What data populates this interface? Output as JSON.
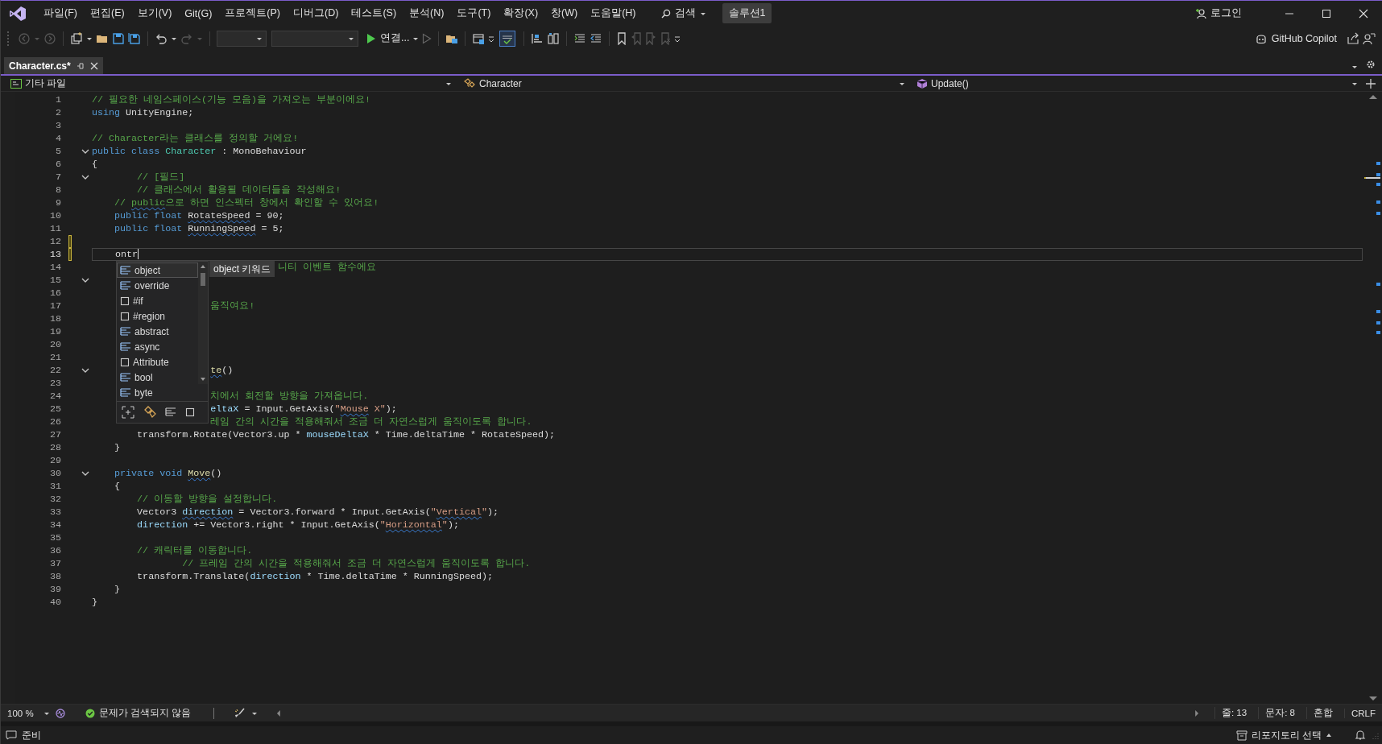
{
  "title_bar": {
    "menu": [
      "파일(F)",
      "편집(E)",
      "보기(V)",
      "Git(G)",
      "프로젝트(P)",
      "디버그(D)",
      "테스트(S)",
      "분석(N)",
      "도구(T)",
      "확장(X)",
      "창(W)",
      "도움말(H)"
    ],
    "search": "검색",
    "solution": "솔루션1",
    "login": "로그인"
  },
  "toolbar": {
    "run_label": "연결...",
    "copilot": "GitHub Copilot"
  },
  "tabs": [
    {
      "label": "Character.cs*",
      "selected": true
    }
  ],
  "nav_bar": {
    "project": "기타 파일",
    "type": "Character",
    "member": "Update()"
  },
  "editor": {
    "lines": [
      {
        "number": "1",
        "fold": false,
        "changed": false,
        "current": false,
        "tokens": [
          {
            "text": "// 필요한 네임스페이스(기능 모음)을 가져오는 부분이에요!",
            "kind": "comment"
          }
        ]
      },
      {
        "number": "2",
        "fold": false,
        "changed": false,
        "current": false,
        "tokens": [
          {
            "text": "using",
            "kind": "keyword"
          },
          {
            "text": " UnityEngine;",
            "kind": "plain"
          }
        ]
      },
      {
        "number": "3",
        "fold": false,
        "changed": false,
        "current": false
      },
      {
        "number": "4",
        "fold": false,
        "changed": false,
        "current": false,
        "tokens": [
          {
            "text": "// Character라는 클래스를 정의할 거에요!",
            "kind": "comment"
          }
        ]
      },
      {
        "number": "5",
        "fold": true,
        "changed": false,
        "current": false,
        "tokens": [
          {
            "text": "public class ",
            "kind": "keyword"
          },
          {
            "text": "Character",
            "kind": "type"
          },
          {
            "text": " : MonoBehaviour",
            "kind": "plain"
          }
        ]
      },
      {
        "number": "6",
        "fold": false,
        "changed": false,
        "current": false,
        "tokens": [
          {
            "text": "{",
            "kind": "plain"
          }
        ]
      },
      {
        "number": "7",
        "fold": true,
        "changed": false,
        "current": false,
        "tokens": [
          {
            "text": "        // [필드]",
            "kind": "comment"
          }
        ]
      },
      {
        "number": "8",
        "fold": false,
        "changed": false,
        "current": false,
        "tokens": [
          {
            "text": "        // 클래스에서 활용될 데이터들을 작성해요!",
            "kind": "comment"
          }
        ]
      },
      {
        "number": "9",
        "fold": false,
        "changed": false,
        "current": false,
        "tokens": [
          {
            "text": "    // ",
            "kind": "comment"
          },
          {
            "text": "public",
            "kind": "comment-squiggle"
          },
          {
            "text": "으로 하면 인스펙터 창에서 확인할 수 있어요!",
            "kind": "comment"
          }
        ]
      },
      {
        "number": "10",
        "fold": false,
        "changed": false,
        "current": false,
        "tokens": [
          {
            "text": "    public float ",
            "kind": "keyword"
          },
          {
            "text": "RotateSpeed",
            "kind": "plain-squiggle"
          },
          {
            "text": " = 90;",
            "kind": "plain"
          }
        ]
      },
      {
        "number": "11",
        "fold": false,
        "changed": false,
        "current": false,
        "tokens": [
          {
            "text": "    public float ",
            "kind": "keyword"
          },
          {
            "text": "RunningSpeed",
            "kind": "plain-squiggle"
          },
          {
            "text": " = 5;",
            "kind": "plain"
          }
        ]
      },
      {
        "number": "12",
        "fold": false,
        "changed": true,
        "current": false
      },
      {
        "number": "13",
        "fold": false,
        "changed": true,
        "current": true,
        "tokens": [
          {
            "text": "    ontr",
            "kind": "plain"
          }
        ]
      },
      {
        "number": "14",
        "fold": false,
        "changed": false,
        "current": false,
        "tokens": [
          {
            "text": "                                 니티 이벤트 함수에요",
            "kind": "comment"
          }
        ]
      },
      {
        "number": "15",
        "fold": true,
        "changed": false,
        "current": false
      },
      {
        "number": "16",
        "fold": false,
        "changed": false,
        "current": false
      },
      {
        "number": "17",
        "fold": false,
        "changed": false,
        "current": false,
        "tokens": [
          {
            "text": "                     움직여요!",
            "kind": "comment"
          }
        ]
      },
      {
        "number": "18",
        "fold": false,
        "changed": false,
        "current": false
      },
      {
        "number": "19",
        "fold": false,
        "changed": false,
        "current": false
      },
      {
        "number": "20",
        "fold": false,
        "changed": false,
        "current": false
      },
      {
        "number": "21",
        "fold": false,
        "changed": false,
        "current": false
      },
      {
        "number": "22",
        "fold": true,
        "changed": false,
        "current": false,
        "tokens": [
          {
            "text": "                     te",
            "kind": "method-squiggle"
          },
          {
            "text": "()",
            "kind": "plain"
          }
        ]
      },
      {
        "number": "23",
        "fold": false,
        "changed": false,
        "current": false
      },
      {
        "number": "24",
        "fold": false,
        "changed": false,
        "current": false,
        "tokens": [
          {
            "text": "                     치에서 회전할 방향을 가져옵니다.",
            "kind": "comment"
          }
        ]
      },
      {
        "number": "25",
        "fold": false,
        "changed": false,
        "current": false,
        "tokens": [
          {
            "text": "                     eltaX",
            "kind": "variable"
          },
          {
            "text": " = Input.GetAxis(",
            "kind": "plain"
          },
          {
            "text": "\"",
            "kind": "string"
          },
          {
            "text": "Mouse",
            "kind": "string-squiggle"
          },
          {
            "text": " X\"",
            "kind": "string"
          },
          {
            "text": ");",
            "kind": "plain"
          }
        ]
      },
      {
        "number": "26",
        "fold": false,
        "changed": false,
        "current": false,
        "tokens": [
          {
            "text": "                     레임 간의 시간을 적용해줘서 조금 더 자연스럽게 움직이도록 합니다.",
            "kind": "comment"
          }
        ]
      },
      {
        "number": "27",
        "fold": false,
        "changed": false,
        "current": false,
        "tokens": [
          {
            "text": "        transform.Rotate(Vector3.up * ",
            "kind": "plain"
          },
          {
            "text": "mouseDeltaX",
            "kind": "variable"
          },
          {
            "text": " * Time.deltaTime * RotateSpeed);",
            "kind": "plain"
          }
        ]
      },
      {
        "number": "28",
        "fold": false,
        "changed": false,
        "current": false,
        "tokens": [
          {
            "text": "    }",
            "kind": "plain"
          }
        ]
      },
      {
        "number": "29",
        "fold": false,
        "changed": false,
        "current": false
      },
      {
        "number": "30",
        "fold": true,
        "changed": false,
        "current": false,
        "tokens": [
          {
            "text": "    private void ",
            "kind": "keyword"
          },
          {
            "text": "Move",
            "kind": "method-squiggle"
          },
          {
            "text": "()",
            "kind": "plain"
          }
        ]
      },
      {
        "number": "31",
        "fold": false,
        "changed": false,
        "current": false,
        "tokens": [
          {
            "text": "    {",
            "kind": "plain"
          }
        ]
      },
      {
        "number": "32",
        "fold": false,
        "changed": false,
        "current": false,
        "tokens": [
          {
            "text": "        // 이동할 방향을 설정합니다.",
            "kind": "comment"
          }
        ]
      },
      {
        "number": "33",
        "fold": false,
        "changed": false,
        "current": false,
        "tokens": [
          {
            "text": "        Vector3 ",
            "kind": "plain"
          },
          {
            "text": "direction",
            "kind": "variable-squiggle"
          },
          {
            "text": " = Vector3.forward * Input.GetAxis(",
            "kind": "plain"
          },
          {
            "text": "\"",
            "kind": "string"
          },
          {
            "text": "Vertical",
            "kind": "string-squiggle"
          },
          {
            "text": "\"",
            "kind": "string"
          },
          {
            "text": ");",
            "kind": "plain"
          }
        ]
      },
      {
        "number": "34",
        "fold": false,
        "changed": false,
        "current": false,
        "tokens": [
          {
            "text": "        direction",
            "kind": "variable"
          },
          {
            "text": " += Vector3.right * Input.GetAxis(",
            "kind": "plain"
          },
          {
            "text": "\"",
            "kind": "string"
          },
          {
            "text": "Horizontal",
            "kind": "string-squiggle"
          },
          {
            "text": "\"",
            "kind": "string"
          },
          {
            "text": ");",
            "kind": "plain"
          }
        ]
      },
      {
        "number": "35",
        "fold": false,
        "changed": false,
        "current": false
      },
      {
        "number": "36",
        "fold": false,
        "changed": false,
        "current": false,
        "tokens": [
          {
            "text": "        // 캐릭터를 이동합니다.",
            "kind": "comment"
          }
        ]
      },
      {
        "number": "37",
        "fold": false,
        "changed": false,
        "current": false,
        "tokens": [
          {
            "text": "                // 프레임 간의 시간을 적용해줘서 조금 더 자연스럽게 움직이도록 합니다.",
            "kind": "comment"
          }
        ]
      },
      {
        "number": "38",
        "fold": false,
        "changed": false,
        "current": false,
        "tokens": [
          {
            "text": "        transform.Translate(",
            "kind": "plain"
          },
          {
            "text": "direction",
            "kind": "variable"
          },
          {
            "text": " * Time.deltaTime * RunningSpeed);",
            "kind": "plain"
          }
        ]
      },
      {
        "number": "39",
        "fold": false,
        "changed": false,
        "current": false,
        "tokens": [
          {
            "text": "    }",
            "kind": "plain"
          }
        ]
      },
      {
        "number": "40",
        "fold": false,
        "changed": false,
        "current": false,
        "tokens": [
          {
            "text": "}",
            "kind": "plain"
          }
        ]
      }
    ],
    "completion": {
      "items": [
        {
          "label": "object",
          "kind": "keyword",
          "selected": true
        },
        {
          "label": "override",
          "kind": "keyword",
          "selected": false
        },
        {
          "label": "#if",
          "kind": "snippet",
          "selected": false
        },
        {
          "label": "#region",
          "kind": "snippet",
          "selected": false
        },
        {
          "label": "abstract",
          "kind": "keyword",
          "selected": false
        },
        {
          "label": "async",
          "kind": "keyword",
          "selected": false
        },
        {
          "label": "Attribute",
          "kind": "snippet",
          "selected": false
        },
        {
          "label": "bool",
          "kind": "keyword",
          "selected": false
        },
        {
          "label": "byte",
          "kind": "keyword",
          "selected": false
        }
      ],
      "tooltip": "object 키워드"
    }
  },
  "editor_status": {
    "zoom": "100 %",
    "issues": "문제가 검색되지 않음",
    "line": "줄: 13",
    "column": "문자: 8",
    "whitespace": "혼합",
    "line_ending": "CRLF"
  },
  "status_bar": {
    "state": "준비",
    "repository": "리포지토리 선택"
  }
}
